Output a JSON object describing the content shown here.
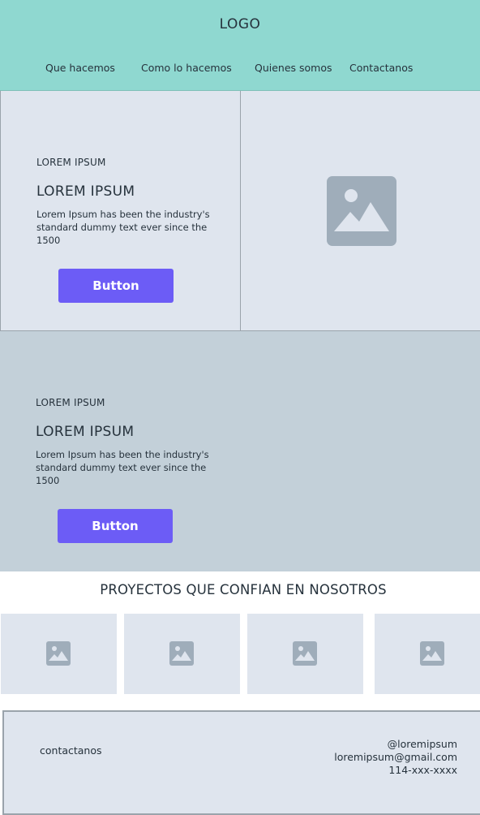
{
  "header": {
    "logo": "LOGO",
    "nav": [
      "Que hacemos",
      "Como lo hacemos",
      "Quienes somos",
      "Contactanos"
    ]
  },
  "hero": {
    "kicker": "LOREM IPSUM",
    "heading": "LOREM IPSUM",
    "body": "Lorem Ipsum has been the industry's standard dummy text ever since the 1500",
    "button_label": "Button",
    "image_icon": "image-placeholder-icon"
  },
  "section2": {
    "kicker": "LOREM IPSUM",
    "heading": "LOREM IPSUM",
    "body": "Lorem Ipsum has been the industry's standard dummy text ever since the 1500",
    "button_label": "Button"
  },
  "projects": {
    "title": "PROYECTOS QUE CONFIAN EN NOSOTROS",
    "thumb_icon": "image-placeholder-icon"
  },
  "footer": {
    "left": "contactanos",
    "handle": "@loremipsum",
    "email": "loremipsum@gmail.com",
    "phone": "114-xxx-xxxx"
  },
  "colors": {
    "header_bg": "#8fd8d0",
    "panel_bg": "#dfe5ee",
    "section2_bg": "#c3d0d9",
    "button_bg": "#6c5cf6",
    "placeholder_icon": "#9fadba"
  }
}
